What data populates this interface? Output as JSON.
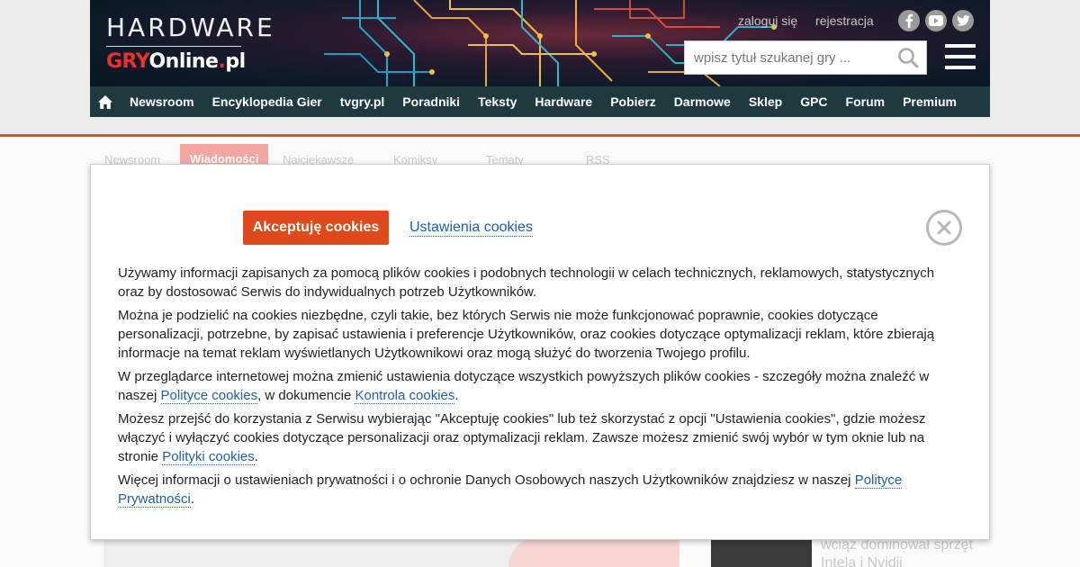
{
  "header": {
    "logo_top": "HARDWARE",
    "logo_brand_red": "GRY",
    "logo_brand_white": "Online",
    "logo_brand_dot": ".",
    "logo_brand_tld": "pl",
    "login": "zaloguj się",
    "register": "rejestracja",
    "social_icons": [
      "facebook-icon",
      "youtube-icon",
      "twitter-icon"
    ],
    "search_placeholder": "wpisz tytuł szukanej gry ..."
  },
  "nav": {
    "items": [
      "Newsroom",
      "Encyklopedia Gier",
      "tvgry.pl",
      "Poradniki",
      "Teksty",
      "Hardware",
      "Pobierz",
      "Darmowe",
      "Sklep",
      "GPC",
      "Forum",
      "Premium"
    ]
  },
  "subtabs": {
    "items": [
      "Newsroom",
      "Wiadomości",
      "Najciekawsze",
      "Komiksy",
      "Tematy",
      "RSS"
    ],
    "active": "Wiadomości"
  },
  "behind": {
    "side_text": "wciąż dominował sprzęt Intela i Nvidii"
  },
  "cookie_modal": {
    "accept_label": "Akceptuję cookies",
    "settings_label": "Ustawienia cookies",
    "p1": "Używamy informacji zapisanych za pomocą plików cookies i podobnych technologii w celach technicznych, reklamowych, statystycznych oraz by dostosować Serwis do indywidualnych potrzeb Użytkowników.",
    "p2": "Można je podzielić na cookies niezbędne, czyli takie, bez których Serwis nie może funkcjonować poprawnie, cookies dotyczące personalizacji, potrzebne, by zapisać ustawienia i preferencje Użytkowników, oraz cookies dotyczące optymalizacji reklam, które zbierają informacje na temat reklam wyświetlanych Użytkownikowi oraz mogą służyć do tworzenia Twojego profilu.",
    "p3_a": "W przeglądarce internetowej można zmienić ustawienia dotyczące wszystkich powyższych plików cookies - szczegóły można znaleźć w naszej ",
    "p3_link1": "Polityce cookies",
    "p3_b": ", w dokumencie ",
    "p3_link2": "Kontrola cookies",
    "p3_c": ".",
    "p4_a": "Możesz przejść do korzystania z Serwisu wybierając \"Akceptuję cookies\" lub też skorzystać z opcji \"Ustawienia cookies\", gdzie możesz włączyć i wyłączyć cookies dotyczące personalizacji oraz optymalizacji reklam. Zawsze możesz zmienić swój wybór w tym oknie lub na stronie ",
    "p4_link": "Polityki cookies",
    "p4_b": ".",
    "p5_a": "Więcej informacji o ustawieniach prywatności i o ochronie Danych Osobowych naszych Użytkowników znajdziesz w naszej ",
    "p5_link": "Polityce Prywatności",
    "p5_b": "."
  },
  "colors": {
    "accent": "#e0491a",
    "nav_bg": "#1f3a3f",
    "link": "#1a5fa8"
  }
}
